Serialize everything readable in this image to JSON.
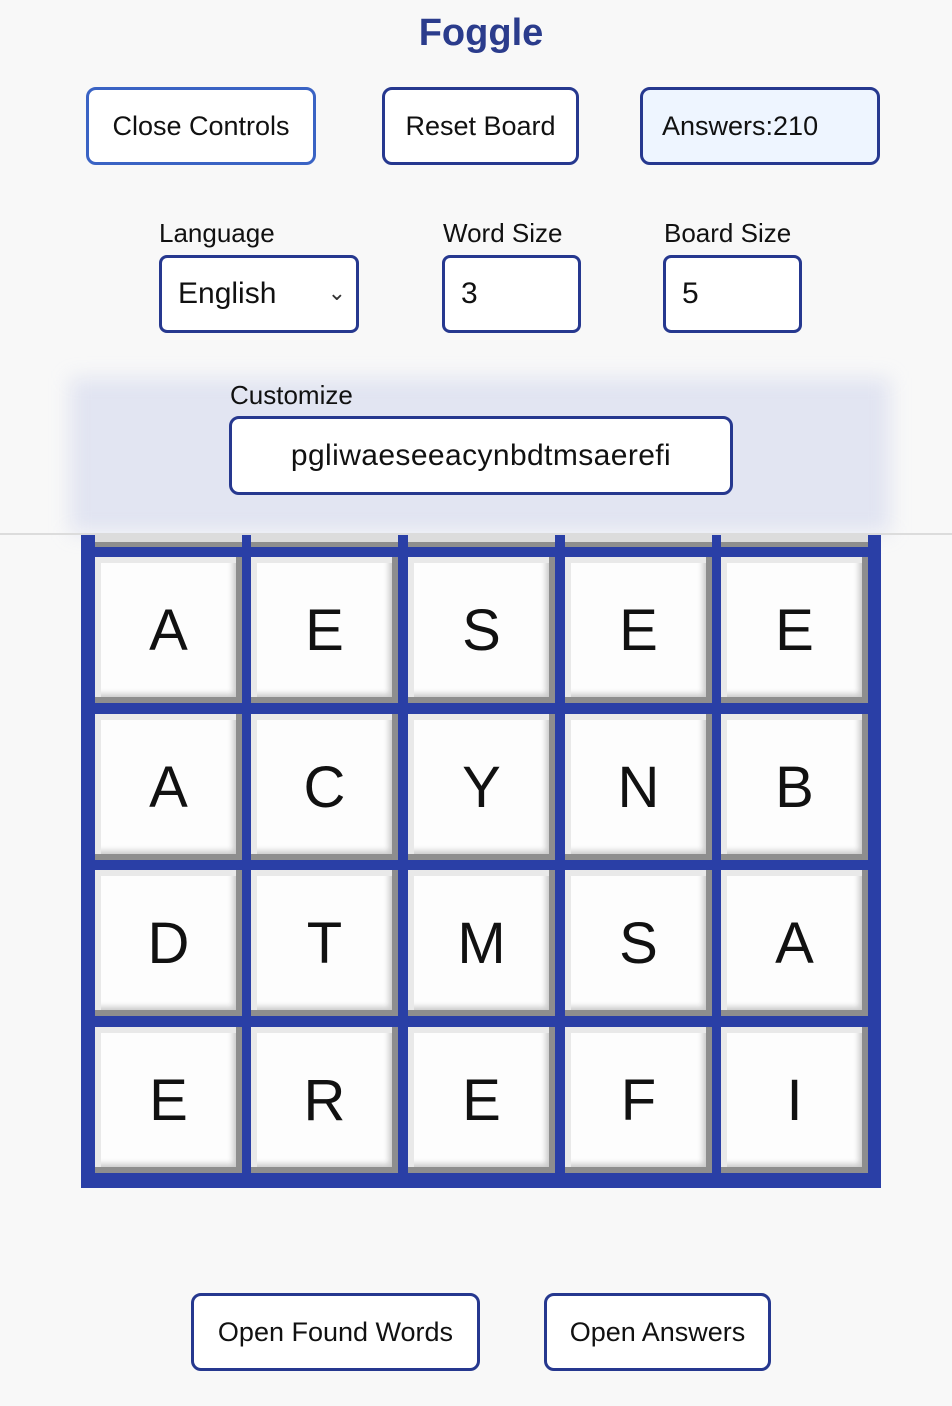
{
  "app": {
    "title": "Foggle"
  },
  "controls": {
    "close_label": "Close Controls",
    "reset_label": "Reset Board",
    "answers_label": "Answers:210",
    "language_label": "Language",
    "language_value": "English",
    "word_size_label": "Word Size",
    "word_size_value": "3",
    "board_size_label": "Board Size",
    "board_size_value": "5",
    "customize_label": "Customize",
    "customize_value": "pgliwaeseeacynbdtmsaerefi"
  },
  "board": {
    "rows": [
      [
        "A",
        "E",
        "S",
        "E",
        "E"
      ],
      [
        "A",
        "C",
        "Y",
        "N",
        "B"
      ],
      [
        "D",
        "T",
        "M",
        "S",
        "A"
      ],
      [
        "E",
        "R",
        "E",
        "F",
        "I"
      ]
    ]
  },
  "footer": {
    "found_words_label": "Open Found Words",
    "answers_label": "Open Answers"
  },
  "colors": {
    "accent": "#2a3fa6",
    "title": "#2b3c8c"
  }
}
